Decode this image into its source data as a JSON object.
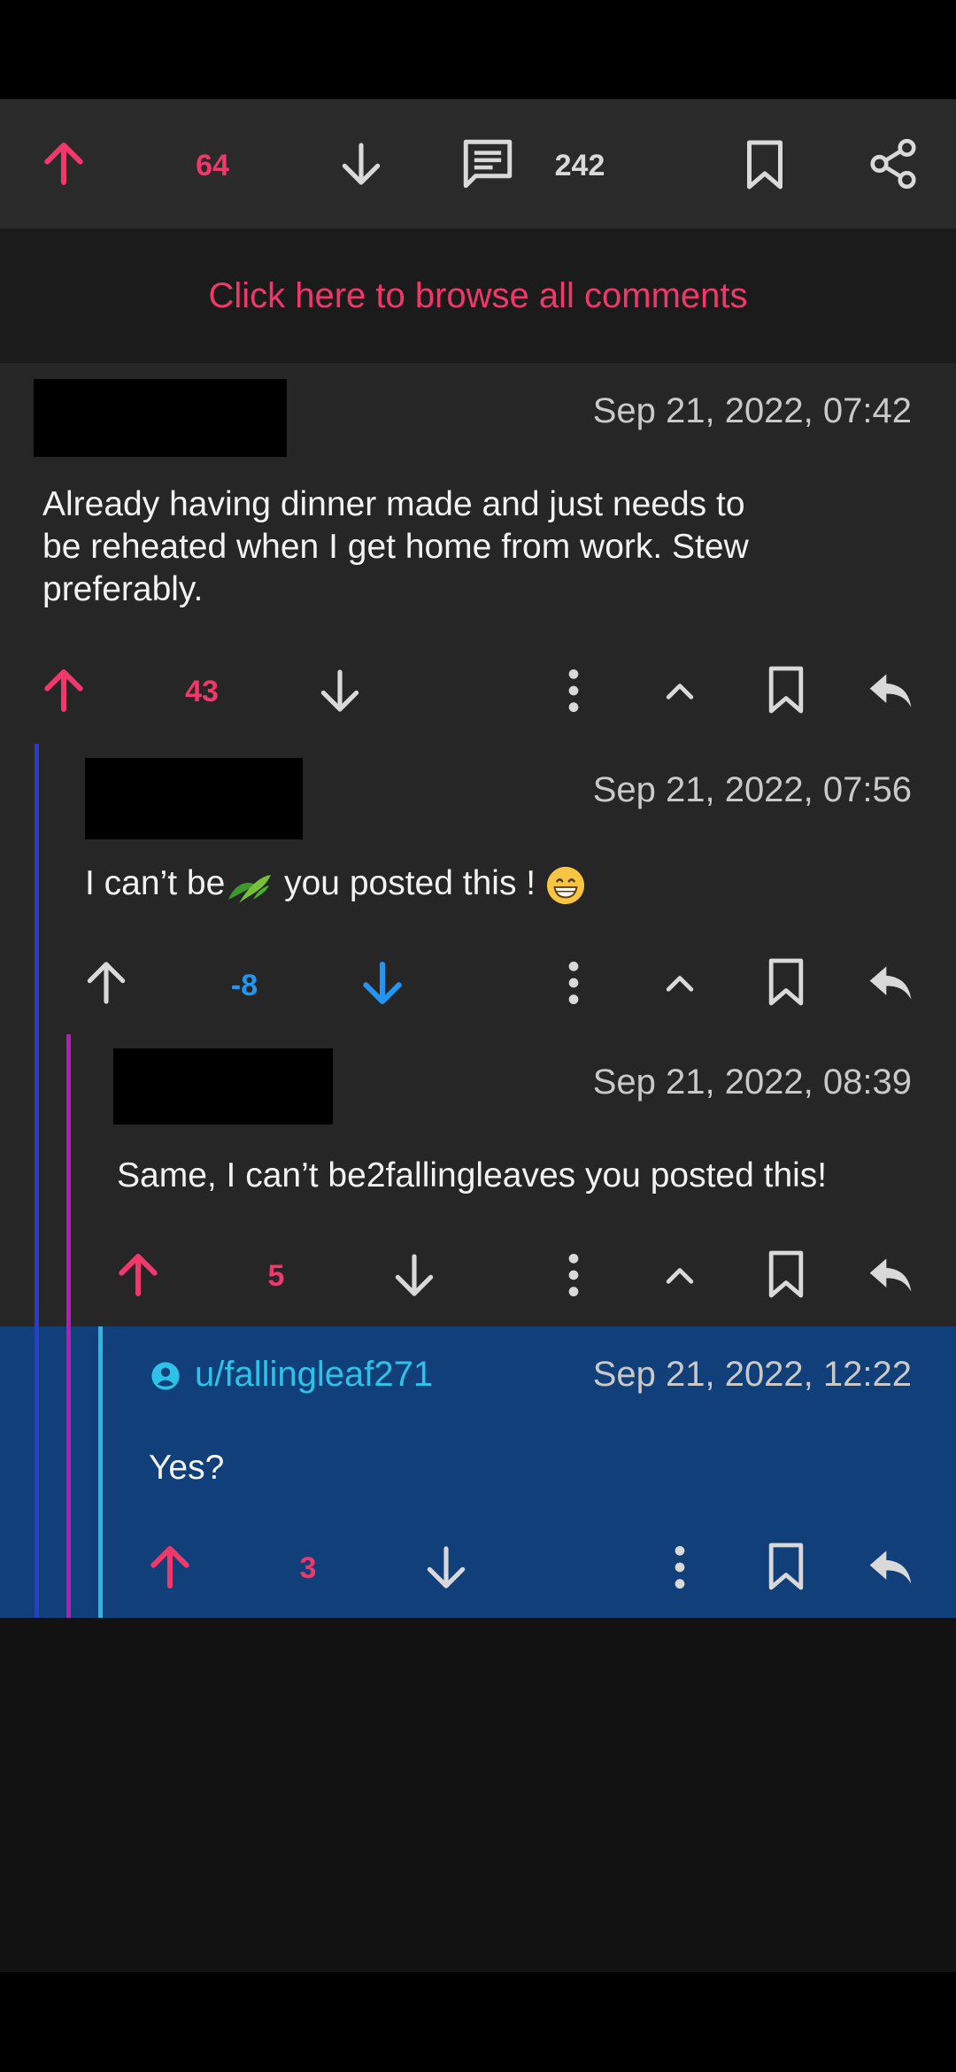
{
  "post_bar": {
    "upvotes": "64",
    "comment_count": "242",
    "icons": [
      "arrow-up-icon",
      "arrow-down-icon",
      "comment-icon",
      "bookmark-icon",
      "share-icon"
    ]
  },
  "browse_all": "Click here to browse all comments",
  "colors": {
    "accent": "#f0386b",
    "downvote": "#2196f3",
    "link": "#2fc2e8",
    "selected_bg": "#113f79",
    "thread_level_1": "#2a3bd0",
    "thread_level_2": "#b51db8",
    "thread_level_3": "#2ab8e0"
  },
  "comments": [
    {
      "date": "Sep 21, 2022, 07:42",
      "text_lines": [
        "Already having dinner made and just needs to",
        "be reheated when I get home from work.  Stew",
        "preferably."
      ],
      "score": "43",
      "vote": "up"
    },
    {
      "date": "Sep 21, 2022, 07:56",
      "text_before": "I can’t be",
      "text_after": " you posted this ! ",
      "score": "-8",
      "vote": "down"
    },
    {
      "date": "Sep 21, 2022, 08:39",
      "text": "Same, I can’t be2fallingleaves you posted this!",
      "score": "5",
      "vote": "up"
    },
    {
      "author": "u/fallingleaf271",
      "date": "Sep 21, 2022, 12:22",
      "text": "Yes?",
      "score": "3",
      "vote": "up"
    }
  ]
}
